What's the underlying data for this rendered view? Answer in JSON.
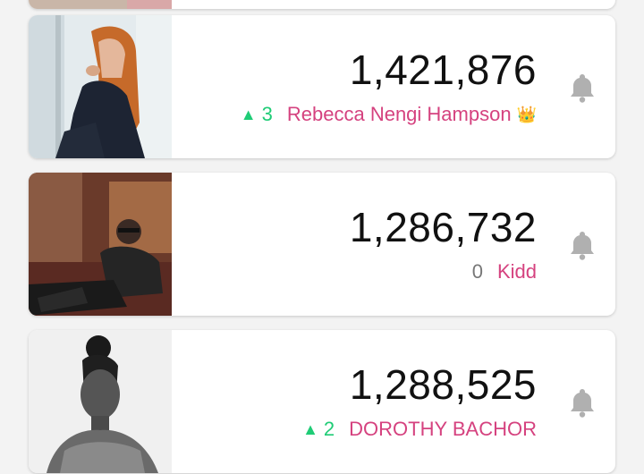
{
  "contestants": [
    {
      "score": "1,421,876",
      "trend": "up",
      "trend_arrow": "▲",
      "change": "3",
      "name": "Rebecca Nengi Hampson",
      "crown": "👑"
    },
    {
      "score": "1,286,732",
      "trend": "same",
      "trend_arrow": "",
      "change": "0",
      "name": "Kidd",
      "crown": ""
    },
    {
      "score": "1,288,525",
      "trend": "up",
      "trend_arrow": "▲",
      "change": "2",
      "name": "DOROTHY BACHOR",
      "crown": ""
    }
  ],
  "icons": {
    "notify": "bell-icon",
    "rank_up": "triangle-up-icon",
    "top": "crown-icon"
  },
  "colors": {
    "name": "#d5427f",
    "rank_up": "#1fcc76",
    "rank_same": "#777777",
    "score": "#111111",
    "bell": "#b0b0b0",
    "background": "#f3f3f3"
  }
}
